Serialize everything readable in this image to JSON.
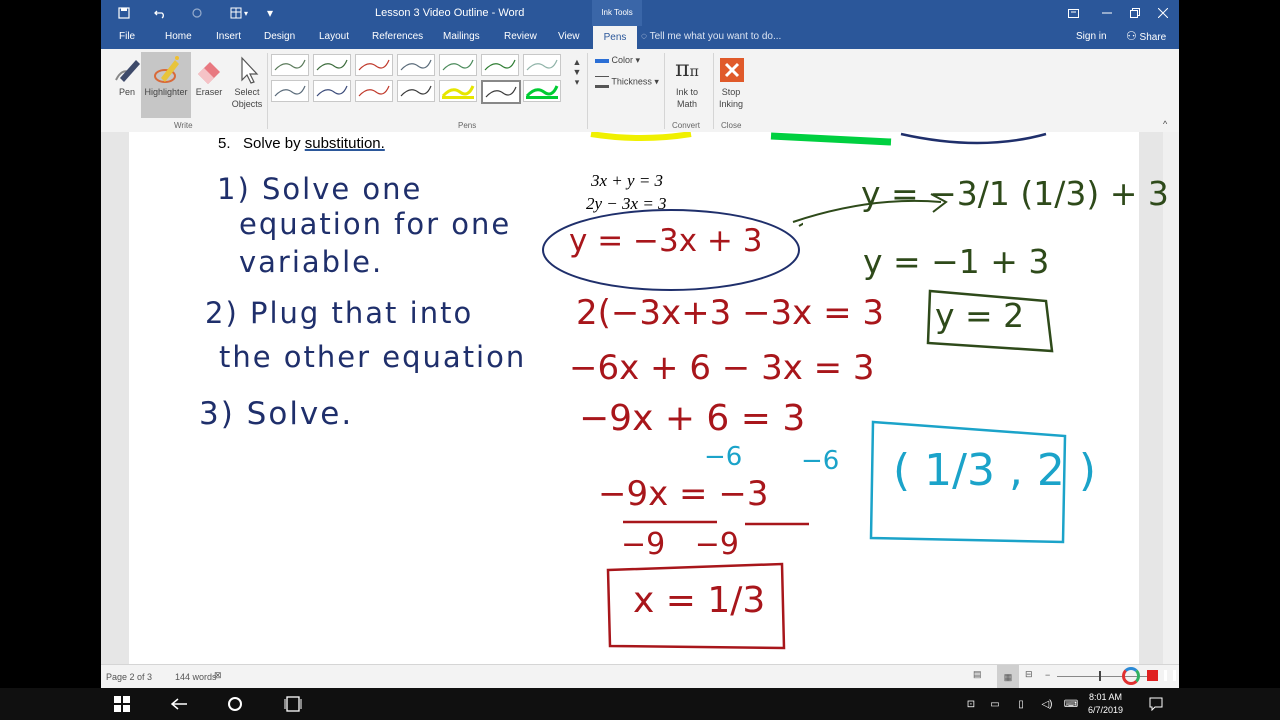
{
  "window": {
    "title": "Lesson 3 Video Outline - Word",
    "context_tab_group": "Ink Tools"
  },
  "qat": {
    "customize": "▾"
  },
  "tabs": [
    "File",
    "Home",
    "Insert",
    "Design",
    "Layout",
    "References",
    "Mailings",
    "Review",
    "View",
    "Pens"
  ],
  "active_tab": "Pens",
  "tell_me": "Tell me what you want to do...",
  "account": {
    "sign_in": "Sign in",
    "share": "Share"
  },
  "ribbon": {
    "write": {
      "label": "Write",
      "pen": "Pen",
      "highlighter": "Highlighter",
      "eraser": "Eraser",
      "select_objects_1": "Select",
      "select_objects_2": "Objects"
    },
    "pens": {
      "label": "Pens",
      "color": "Color",
      "thickness": "Thickness",
      "pen_colors": [
        "#5a7a5a",
        "#3b6b3b",
        "#c0392b",
        "#5a6b7a",
        "#4a8a5a",
        "#2e7d32",
        "#8fb3a8",
        "#5a6b7a",
        "#3b4b7a",
        "#c0392b",
        "#3a3a3a",
        "#e6e600",
        "#3a3a3a",
        "#00cc33"
      ]
    },
    "convert": {
      "label": "Convert",
      "ink_to_math_1": "Ink to",
      "ink_to_math_2": "Math"
    },
    "close": {
      "label": "Close",
      "stop_inking_1": "Stop",
      "stop_inking_2": "Inking"
    }
  },
  "document": {
    "question_number": "5.",
    "question_text": "Solve by",
    "question_word": "substitution.",
    "eq1": "3x + y = 3",
    "eq2": "2y − 3x = 3",
    "steps": {
      "step1_line1": "1) Solve one",
      "step1_line2": "equation for one",
      "step1_line3": "variable.",
      "step2_line1": "2) Plug that into",
      "step2_line2": "the other equation",
      "step3": "3) Solve."
    },
    "work": {
      "circled": "y = −3x + 3",
      "line1": "2(−3x+3  −3x = 3",
      "line2": "−6x + 6 − 3x = 3",
      "line3": "−9x + 6 = 3",
      "sub_left": "−6",
      "sub_right": "−6",
      "line4": "−9x = −3",
      "denominators": "−9   −9",
      "answer_x": "x = 1/3"
    },
    "y_work": {
      "line1": "y = −3/1 (1/3) + 3",
      "line2": "y = −1 + 3",
      "answer_y": "y = 2"
    },
    "solution": "( 1/3 , 2 )"
  },
  "status": {
    "page": "Page 2 of 3",
    "words": "144 words"
  },
  "clock": {
    "time": "8:01 AM",
    "date": "6/7/2019"
  }
}
